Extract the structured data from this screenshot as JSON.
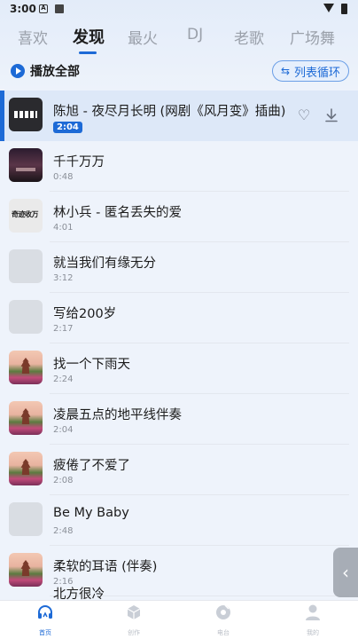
{
  "status_bar": {
    "time": "3:00"
  },
  "tabs": [
    {
      "label": "喜欢"
    },
    {
      "label": "发现"
    },
    {
      "label": "最火"
    },
    {
      "label": "DJ"
    },
    {
      "label": "老歌"
    },
    {
      "label": "广场舞"
    }
  ],
  "active_tab": "发现",
  "toolbar": {
    "play_all_label": "播放全部",
    "loop_label": "列表循环"
  },
  "songs": [
    {
      "title": "陈旭 - 夜尽月长明 (网剧《风月变》插曲)",
      "duration": "2:04",
      "art": "bars"
    },
    {
      "title": "千千万万",
      "duration": "0:48",
      "art": "night"
    },
    {
      "title": "林小兵 - 匿名丢失的爱",
      "duration": "4:01",
      "art": "logo",
      "art_text": "奇迹收万"
    },
    {
      "title": "就当我们有缘无分",
      "duration": "3:12",
      "art": "placeholder"
    },
    {
      "title": "写给200岁",
      "duration": "2:17",
      "art": "placeholder"
    },
    {
      "title": "找一个下雨天",
      "duration": "2:24",
      "art": "flower"
    },
    {
      "title": "凌晨五点的地平线伴奏",
      "duration": "2:04",
      "art": "flower"
    },
    {
      "title": "疲倦了不爱了",
      "duration": "2:08",
      "art": "flower"
    },
    {
      "title": "Be My Baby",
      "duration": "2:48",
      "art": "placeholder"
    },
    {
      "title": "柔软的耳语 (伴奏)",
      "duration": "2:16",
      "art": "flower"
    }
  ],
  "partial_row_title": "北方很冷",
  "side_handle_glyph": "‹",
  "bottom_nav": [
    {
      "label": "首页",
      "icon": "headphones-icon"
    },
    {
      "label": "创作",
      "icon": "cube-icon"
    },
    {
      "label": "电台",
      "icon": "record-icon"
    },
    {
      "label": "我的",
      "icon": "user-icon"
    }
  ],
  "colors": {
    "accent": "#1d6ad6",
    "active_row_bg": "#dde8f8"
  }
}
